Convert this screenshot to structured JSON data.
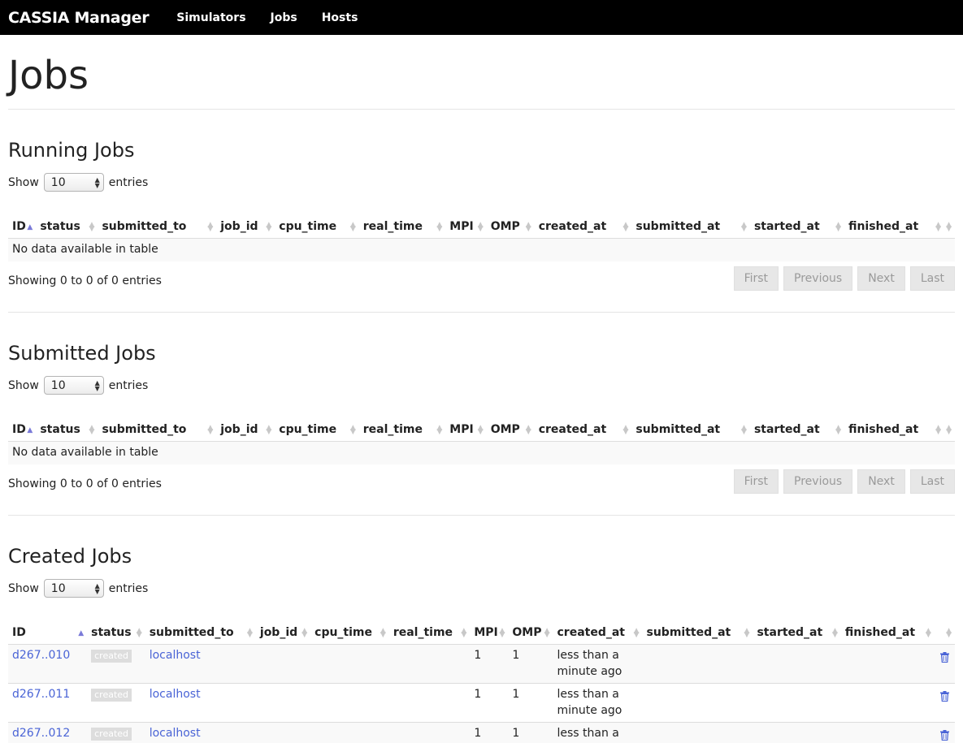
{
  "nav": {
    "brand": "CASSIA Manager",
    "links": [
      "Simulators",
      "Jobs",
      "Hosts"
    ]
  },
  "page_title": "Jobs",
  "columns": [
    "ID",
    "status",
    "submitted_to",
    "job_id",
    "cpu_time",
    "real_time",
    "MPI",
    "OMP",
    "created_at",
    "submitted_at",
    "started_at",
    "finished_at",
    ""
  ],
  "length": {
    "show": "Show",
    "value": "10",
    "entries": "entries"
  },
  "pager": [
    "First",
    "Previous",
    "Next",
    "Last"
  ],
  "running": {
    "title": "Running Jobs",
    "empty": "No data available in table",
    "info": "Showing 0 to 0 of 0 entries"
  },
  "submitted": {
    "title": "Submitted Jobs",
    "empty": "No data available in table",
    "info": "Showing 0 to 0 of 0 entries"
  },
  "created": {
    "title": "Created Jobs",
    "rows": [
      {
        "id": "d267..010",
        "status": "created",
        "submitted_to": "localhost",
        "mpi": "1",
        "omp": "1",
        "created_at": "less than a minute ago"
      },
      {
        "id": "d267..011",
        "status": "created",
        "submitted_to": "localhost",
        "mpi": "1",
        "omp": "1",
        "created_at": "less than a minute ago"
      },
      {
        "id": "d267..012",
        "status": "created",
        "submitted_to": "localhost",
        "mpi": "1",
        "omp": "1",
        "created_at": "less than a minute ago"
      }
    ]
  },
  "icons": {
    "sort_asc": "sort-asc-icon",
    "sort_both": "sort-both-icon",
    "delete": "trash-icon"
  }
}
